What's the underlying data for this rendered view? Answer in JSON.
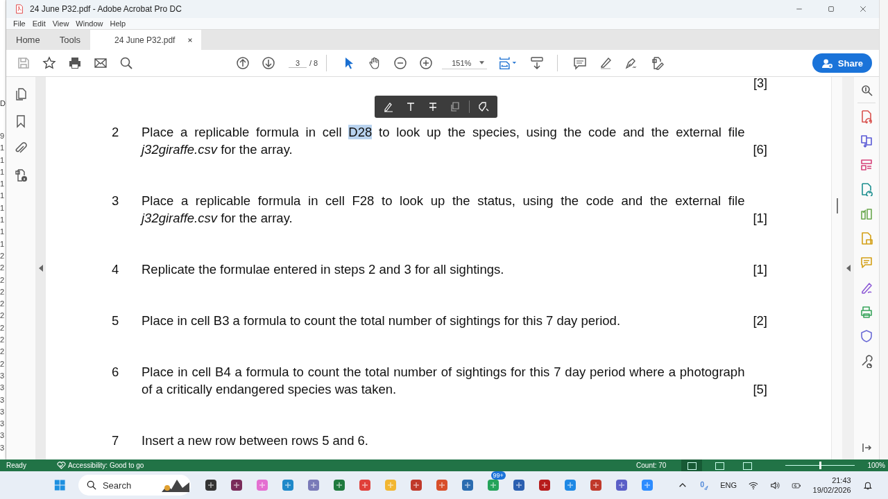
{
  "window": {
    "title": "24 June P32.pdf - Adobe Acrobat Pro DC"
  },
  "menu": [
    "File",
    "Edit",
    "View",
    "Window",
    "Help"
  ],
  "tabs": [
    {
      "label": "Home",
      "selected": false
    },
    {
      "label": "Tools",
      "selected": false
    },
    {
      "label": "24 June P32.pdf",
      "selected": true
    }
  ],
  "toolbar": {
    "page": "3",
    "page_total": "/ 8",
    "zoom": "151%",
    "share": "Share"
  },
  "document": {
    "top_mark": "[3]",
    "questions": [
      {
        "number": "2",
        "parts": [
          {
            "text": "Place a replicable formula in cell ",
            "kind": "plain"
          },
          {
            "text": "D28",
            "kind": "highlight"
          },
          {
            "text": " to look up the species, using the code and the external file ",
            "kind": "plain"
          },
          {
            "text": "j32giraffe.csv",
            "kind": "italic"
          },
          {
            "text": " for the array.",
            "kind": "plain"
          }
        ],
        "mark": "[6]"
      },
      {
        "number": "3",
        "parts": [
          {
            "text": "Place a replicable formula in cell F28 to look up the status, using the code and the external file ",
            "kind": "plain"
          },
          {
            "text": "j32giraffe.csv",
            "kind": "italic"
          },
          {
            "text": " for the array.",
            "kind": "plain"
          }
        ],
        "mark": "[1]"
      },
      {
        "number": "4",
        "parts": [
          {
            "text": "Replicate the formulae entered in steps 2 and 3 for all sightings.",
            "kind": "plain"
          }
        ],
        "mark": "[1]"
      },
      {
        "number": "5",
        "parts": [
          {
            "text": "Place in cell B3 a formula to count the total number of sightings for this 7 day period.",
            "kind": "plain"
          }
        ],
        "mark": "[2]"
      },
      {
        "number": "6",
        "parts": [
          {
            "text": "Place in cell B4 a formula to count the total number of sightings for this 7 day period where a photograph of a critically endangered species was taken.",
            "kind": "plain"
          }
        ],
        "mark": "[5]"
      },
      {
        "number": "7",
        "parts": [
          {
            "text": "Insert a new row between rows 5 and 6.",
            "kind": "plain"
          }
        ]
      }
    ]
  },
  "excel_behind": {
    "name_box": "D",
    "row_numbers": [
      "9",
      "1",
      "1",
      "1",
      "1",
      "1",
      "1",
      "1",
      "1",
      "1",
      "2",
      "2",
      "2",
      "2",
      "2",
      "2",
      "2",
      "2",
      "2",
      "2",
      "3",
      "3",
      "3",
      "3",
      "3",
      "3",
      "3"
    ],
    "status": "Ready",
    "accessibility": "Accessibility: Good to go",
    "count": "Count: 70",
    "zoom_slider": {
      "level": 0.5
    },
    "zoom": "100%"
  },
  "taskbar": {
    "search": "Search",
    "badge": "99+",
    "language": "ENG",
    "time": "21:43",
    "date": "19/02/2026"
  }
}
